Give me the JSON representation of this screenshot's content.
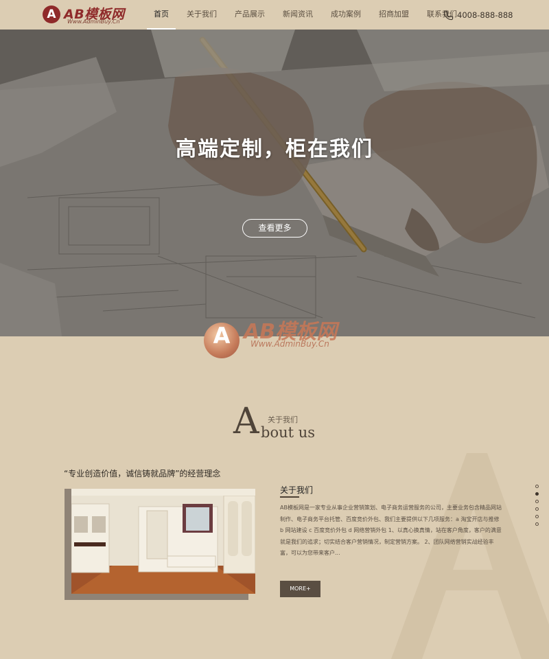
{
  "brand": {
    "logo_letter": "A",
    "logo_name": "AB模板网",
    "logo_url": "Www.AdminBuy.Cn"
  },
  "nav": {
    "items": [
      {
        "label": "首页",
        "active": true
      },
      {
        "label": "关于我们"
      },
      {
        "label": "产品展示"
      },
      {
        "label": "新闻资讯"
      },
      {
        "label": "成功案例"
      },
      {
        "label": "招商加盟"
      },
      {
        "label": "联系我们"
      }
    ],
    "phone": "4008-888-888"
  },
  "hero": {
    "title": "高端定制，柜在我们",
    "button_label": "查看更多"
  },
  "watermark": {
    "letter": "A",
    "title": "AB模板网",
    "url": "Www.AdminBuy.Cn"
  },
  "about": {
    "heading_letter": "A",
    "heading_cn": "关于我们",
    "heading_en": "bout us",
    "slogan": "“专业创造价值，诚信铸就品牌”的经营理念",
    "title": "关于我们",
    "text": "AB模板网是一家专业从事企业营销策划、电子商务运营服务的公司，主要业务包含精品网站制作、电子商务平台托管、百度竞价外包、我们主要提供以下几项服务：a 淘宝开店与推修 b 网站建设 c 百度竞价外包 d 网络营销外包 1、以真心换真情，站在客户角度，客户的满意就是我们的追求；切实结合客户营销情况，制定营销方案。 2、团队网络营销实战经验丰富，可以为您带来客户...",
    "more_label": "MORE+"
  },
  "colors": {
    "background": "#dccdb3",
    "brand_red": "#8f2a2a",
    "dark_brown": "#5a4e42"
  }
}
